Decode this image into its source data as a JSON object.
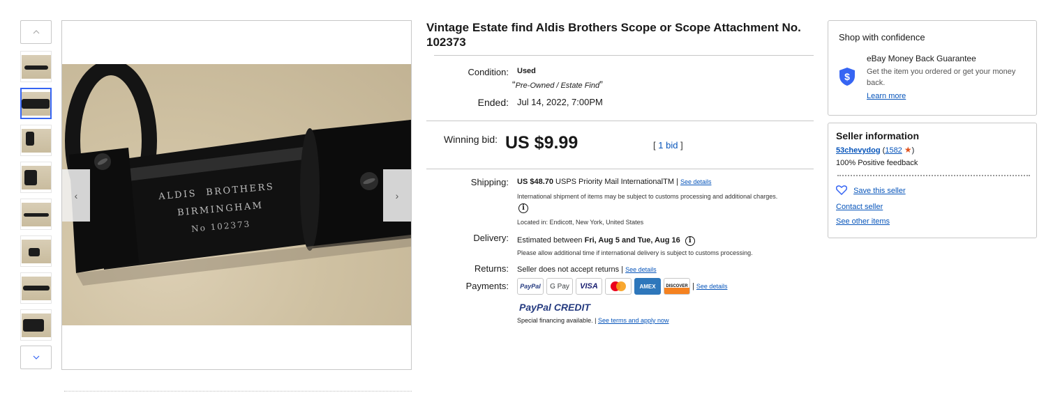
{
  "gallery": {
    "up_arrow": "^",
    "down_arrow": "v",
    "prev_arrow": "‹",
    "next_arrow": "›",
    "thumbnail_count": 8,
    "selected_index": 1,
    "photo_engraving": [
      "ALDIS  BROTHERS",
      "BIRMINGHAM",
      "No 102373"
    ]
  },
  "listing": {
    "title": "Vintage Estate find Aldis Brothers Scope or Scope Attachment No. 102373",
    "condition_label": "Condition:",
    "condition_value": "Used",
    "condition_note": "Pre-Owned / Estate Find",
    "ended_label": "Ended:",
    "ended_value": "Jul 14, 2022, 7:00PM",
    "bid_label": "Winning bid:",
    "bid_price": "US $9.99",
    "bid_count": "1 bid",
    "bid_bracket_open": "[",
    "bid_bracket_close": "]"
  },
  "shipping": {
    "label": "Shipping:",
    "price": "US $48.70",
    "service": "USPS Priority Mail InternationalTM |",
    "details_link": "See details",
    "note": "International shipment of items may be subject to customs processing and additional charges.",
    "location": "Located in: Endicott, New York, United States"
  },
  "delivery": {
    "label": "Delivery:",
    "prefix": "Estimated between ",
    "dates": "Fri, Aug 5 and Tue, Aug 16",
    "note": "Please allow additional time if international delivery is subject to customs processing."
  },
  "returns": {
    "label": "Returns:",
    "value": "Seller does not accept returns |",
    "details_link": "See details"
  },
  "payments": {
    "label": "Payments:",
    "methods": [
      "PayPal",
      "G Pay",
      "VISA",
      "Mastercard",
      "AMEX",
      "DISCOVER"
    ],
    "details_link": "See details",
    "paypal_credit": "PayPal CREDIT",
    "financing": "Special financing available. |",
    "financing_link": "See terms and apply now"
  },
  "confidence": {
    "heading": "Shop with confidence",
    "guarantee_title": "eBay Money Back Guarantee",
    "guarantee_text": "Get the item you ordered or get your money back.",
    "learn_more": "Learn more"
  },
  "seller": {
    "heading": "Seller information",
    "name": "53chevydog",
    "feedback_score": "1582",
    "feedback_percent": "100% Positive feedback",
    "save_seller": "Save this seller",
    "contact": "Contact seller",
    "other_items": "See other items"
  },
  "colors": {
    "link": "#0654ba",
    "accent_blue": "#3665f3",
    "star": "#e0531f"
  }
}
